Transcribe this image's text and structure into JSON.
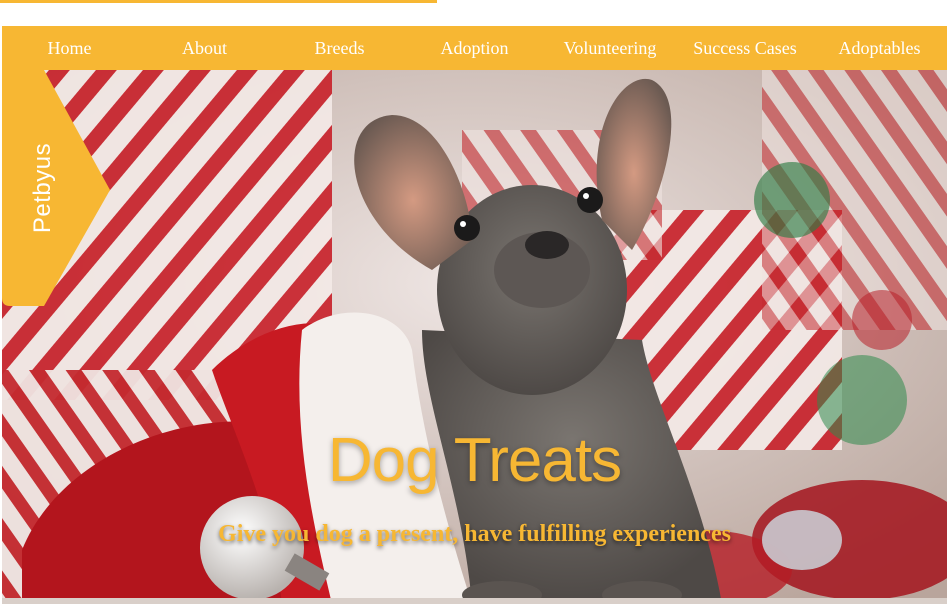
{
  "nav": {
    "items": [
      {
        "label": "Home"
      },
      {
        "label": "About"
      },
      {
        "label": "Breeds"
      },
      {
        "label": "Adoption"
      },
      {
        "label": "Volunteering"
      },
      {
        "label": "Success Cases"
      },
      {
        "label": "Adoptables"
      }
    ]
  },
  "brand": {
    "name": "Petbyus"
  },
  "hero": {
    "title": "Dog Treats",
    "subtitle": "Give you dog a present, have fulfilling experiences",
    "image_alt": "French bulldog puppy among striped gift boxes and a Santa hat"
  },
  "colors": {
    "accent": "#f7b733",
    "nav_text": "#ffffff"
  }
}
